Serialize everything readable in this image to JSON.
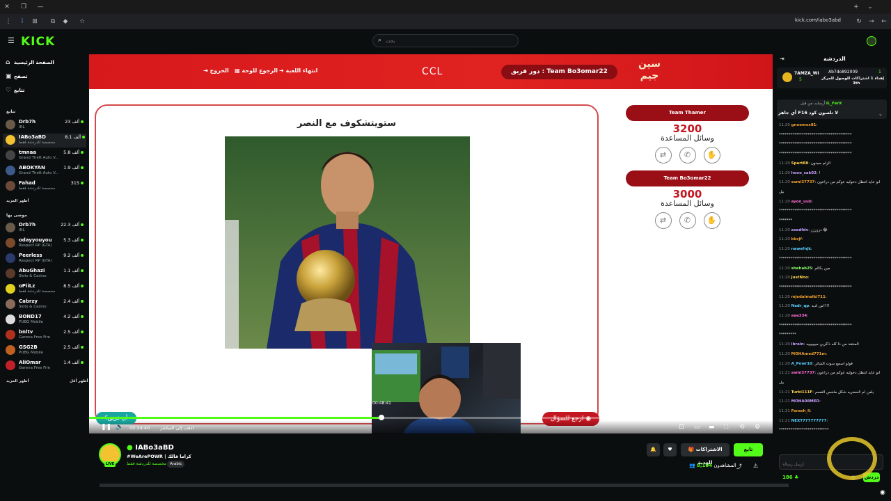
{
  "browser": {
    "url": "kick.com/iabo3abd"
  },
  "topnav": {
    "logo": "KICK",
    "search_placeholder": "بحث"
  },
  "sidebar": {
    "nav": [
      {
        "label": "الصفحة الرئيسية",
        "icon": "home-icon"
      },
      {
        "label": "تصفح",
        "icon": "browse-icon"
      },
      {
        "label": "تتابع",
        "icon": "heart-icon"
      }
    ],
    "following_title": "تتابع",
    "following": [
      {
        "name": "Drb7h",
        "category": "IRL",
        "viewers": "23 ألف"
      },
      {
        "name": "IABo3aBD",
        "category": "مخصصة للدردشة فقط",
        "viewers": "8.1 ألف"
      },
      {
        "name": "tmnaa",
        "category": "Grand Theft Auto V...",
        "viewers": "5.8 ألف"
      },
      {
        "name": "ABOKYAN",
        "category": "Grand Theft Auto V...",
        "viewers": "1.9 ألف"
      },
      {
        "name": "Fahad",
        "category": "مخصصة للدردشة فقط",
        "viewers": "315"
      }
    ],
    "show_more": "أظهر المزيد",
    "recommended_title": "موصى بها",
    "recommended": [
      {
        "name": "Drb7h",
        "category": "IRL",
        "viewers": "22.3 ألف"
      },
      {
        "name": "odayyouyou",
        "category": "Respect RP (GTA)",
        "viewers": "5.3 ألف"
      },
      {
        "name": "Peerless",
        "category": "Respect RP (GTA)",
        "viewers": "9.2 ألف"
      },
      {
        "name": "AbuGhazi",
        "category": "Slots & Casino",
        "viewers": "1.1 ألف"
      },
      {
        "name": "oPiiLz",
        "category": "مخصصة للدردشة فقط",
        "viewers": "8.5 ألف"
      },
      {
        "name": "Cabrzy",
        "category": "Slots & Casino",
        "viewers": "2.4 ألف"
      },
      {
        "name": "BOND17",
        "category": "PUBG Mobile",
        "viewers": "4.2 ألف"
      },
      {
        "name": "bnltv",
        "category": "Garena Free Fire",
        "viewers": "2.5 ألف"
      },
      {
        "name": "GSG2B",
        "category": "PUBG Mobile",
        "viewers": "2.5 ألف"
      },
      {
        "name": "AliOmar",
        "category": "Garena Free Fire",
        "viewers": "1.4 ألف"
      }
    ],
    "show_more2": "أظهر المزيد",
    "show_less": "أظهر أقل"
  },
  "game": {
    "header_exit": "الخروج",
    "header_back": "الرجوع للوحة",
    "header_end": "انتهاء اللعبة",
    "header_ccl": "CCL",
    "header_team": "دور فريق : Team Bo3omar22",
    "brand": "سين جيم",
    "question": "ستويتشكوف مع النصر",
    "teams": [
      {
        "name": "Team Thamer",
        "score": "3200",
        "aids": "وسائل المساعدة"
      },
      {
        "name": "Team Bo3omar22",
        "score": "3000",
        "aids": "وسائل المساعدة"
      }
    ],
    "back_question": "ارجع للسؤال",
    "any_team": "أي فريق؟"
  },
  "player": {
    "time": "00:34:40",
    "live_label": "اذهب إلى المباشر",
    "cam_time": "00:48:41",
    "progress": 0.43
  },
  "stream": {
    "streamer": "IABo3aBD",
    "title": "#WeArePOWR | كراما قالك",
    "category": "مخصصة للدردشة فقط",
    "language": "Arabic",
    "live_badge": "LIVE",
    "follow": "تابع",
    "subscribe": "الاشتراكات للهدية",
    "viewers": "8,104",
    "viewers_label": "المشاهدون"
  },
  "chat": {
    "title": "الدردشة",
    "pinned_user": "Ab7do892009",
    "pinned_count": "1",
    "pinned_text": "إهداء 1 اشتراكات للوصول للمركز",
    "pinned_rank": "3th",
    "top_user": "7AMZA_WI",
    "top_count": "5",
    "notice_user": "IL_FerX",
    "notice_text": "أرسلت من قبل",
    "notice_msg": "أي جاهز F16 لا تلسون كود",
    "messages": [
      {
        "t": "11:20",
        "u": "gnoomxx81",
        "m": ""
      },
      {
        "t": "",
        "u": "",
        "m": "**************************************"
      },
      {
        "t": "",
        "u": "",
        "m": "**************************************"
      },
      {
        "t": "",
        "u": "",
        "m": "**************************************"
      },
      {
        "t": "11:20",
        "u": "Spart88",
        "m": "الزلم مجنون"
      },
      {
        "t": "11:20",
        "u": "hooo_sak02",
        "m": "!"
      },
      {
        "t": "11:20",
        "u": "sami37737",
        "m": "انو عايد انتظل دخوليه عوكم من دراعون"
      },
      {
        "t": "",
        "u": "",
        "m": "بيل"
      },
      {
        "t": "11:20",
        "u": "ayoo_uub",
        "m": ""
      },
      {
        "t": "",
        "u": "",
        "m": "**************************************"
      },
      {
        "t": "",
        "u": "",
        "m": "*******"
      },
      {
        "t": "11:20",
        "u": "asedfdv",
        "m": "دززززز 😂"
      },
      {
        "t": "11:20",
        "u": "kbcjf",
        "m": ""
      },
      {
        "t": "11:20",
        "u": "nawefnjk",
        "m": ""
      },
      {
        "t": "",
        "u": "",
        "m": "**************************************"
      },
      {
        "t": "11:20",
        "u": "shehab25",
        "m": "مين بكالم"
      },
      {
        "t": "11:20",
        "u": "JustNno",
        "m": ""
      },
      {
        "t": "",
        "u": "",
        "m": "**************************************"
      },
      {
        "t": "11:20",
        "u": "mjedalmalki711",
        "m": ""
      },
      {
        "t": "11:20",
        "u": "Nadr_qp",
        "m": "س اديه!!!!"
      },
      {
        "t": "11:20",
        "u": "aaa334",
        "m": ""
      },
      {
        "t": "",
        "u": "",
        "m": "**************************************"
      },
      {
        "t": "",
        "u": "",
        "m": "*********"
      },
      {
        "t": "11:20",
        "u": "ibrain",
        "m": "المنتقد من ذا كله ذاكرين ميييييييه"
      },
      {
        "t": "11:20",
        "u": "MOHAmed771m",
        "m": ""
      },
      {
        "t": "11:20",
        "u": "A_Powr10",
        "m": "قولو اسمع سوت الشاثر"
      },
      {
        "t": "11:21",
        "u": "sami37737",
        "m": "انو عايد انتظل دخوليه عوكم من دراعون"
      },
      {
        "t": "",
        "u": "",
        "m": "بيل"
      },
      {
        "t": "11:21",
        "u": "Turki111F",
        "m": "يلعن ام الحضريه شكل ملخص القسم"
      },
      {
        "t": "11:21",
        "u": "MOHA08MED",
        "m": ""
      },
      {
        "t": "11:21",
        "u": "Farash_ll",
        "m": ""
      },
      {
        "t": "11:21",
        "u": "NEXT777777777",
        "m": ""
      },
      {
        "t": "",
        "u": "",
        "m": "**************************"
      }
    ],
    "input_placeholder": "أرسل رسالة",
    "send": "دردش",
    "points": "186"
  }
}
